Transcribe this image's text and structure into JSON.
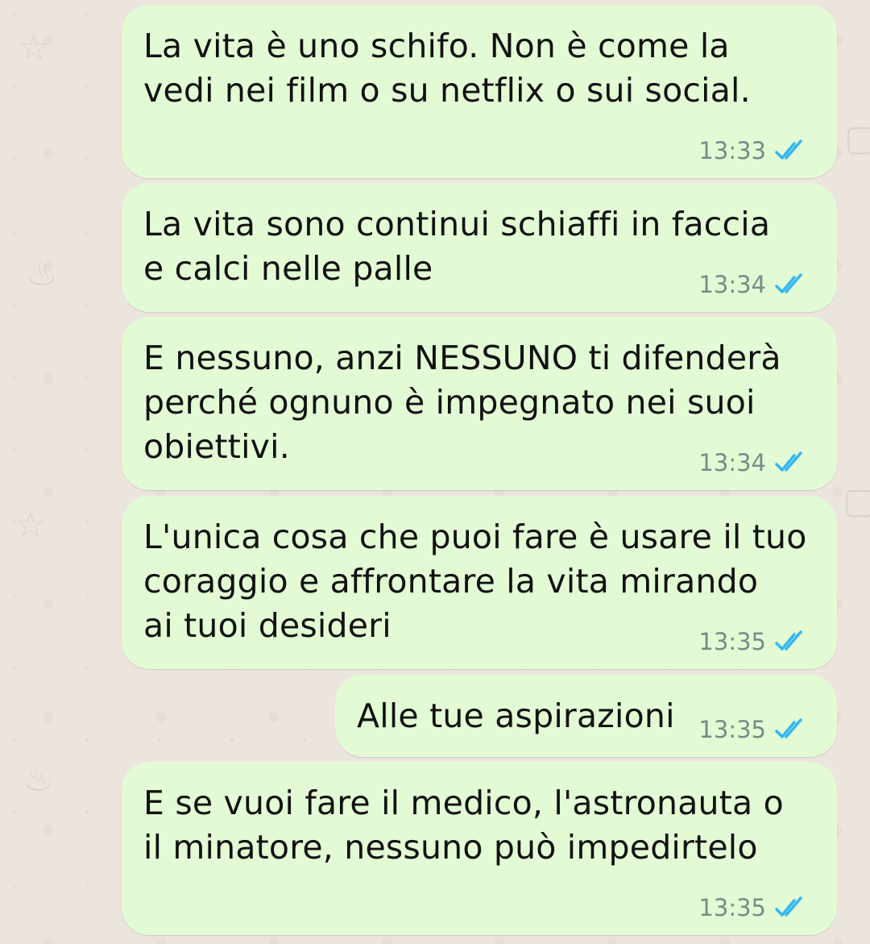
{
  "messages": [
    {
      "text": "La vita è uno schifo. Non è come la\nvedi nei film o su netflix o sui social.",
      "time": "13:33",
      "status_icon": "double-check-read-icon"
    },
    {
      "text": "La vita sono continui schiaffi in faccia\ne calci nelle palle",
      "time": "13:34",
      "status_icon": "double-check-read-icon"
    },
    {
      "text": "E nessuno, anzi NESSUNO ti difenderà\nperché ognuno è impegnato nei suoi\nobiettivi.",
      "time": "13:34",
      "status_icon": "double-check-read-icon"
    },
    {
      "text": "L'unica cosa che puoi fare è usare il tuo\ncoraggio e affrontare la vita mirando\nai tuoi desideri",
      "time": "13:35",
      "status_icon": "double-check-read-icon"
    },
    {
      "text": "Alle tue aspirazioni",
      "time": "13:35",
      "status_icon": "double-check-read-icon"
    },
    {
      "text": "E se vuoi fare il medico, l'astronauta o\nil minatore, nessuno può impedirtelo",
      "time": "13:35",
      "status_icon": "double-check-read-icon"
    }
  ],
  "colors": {
    "bubble": "#e3fbd5",
    "background": "#ece5dd",
    "read_ticks": "#34b7f1",
    "timestamp": "#7a8a86"
  }
}
